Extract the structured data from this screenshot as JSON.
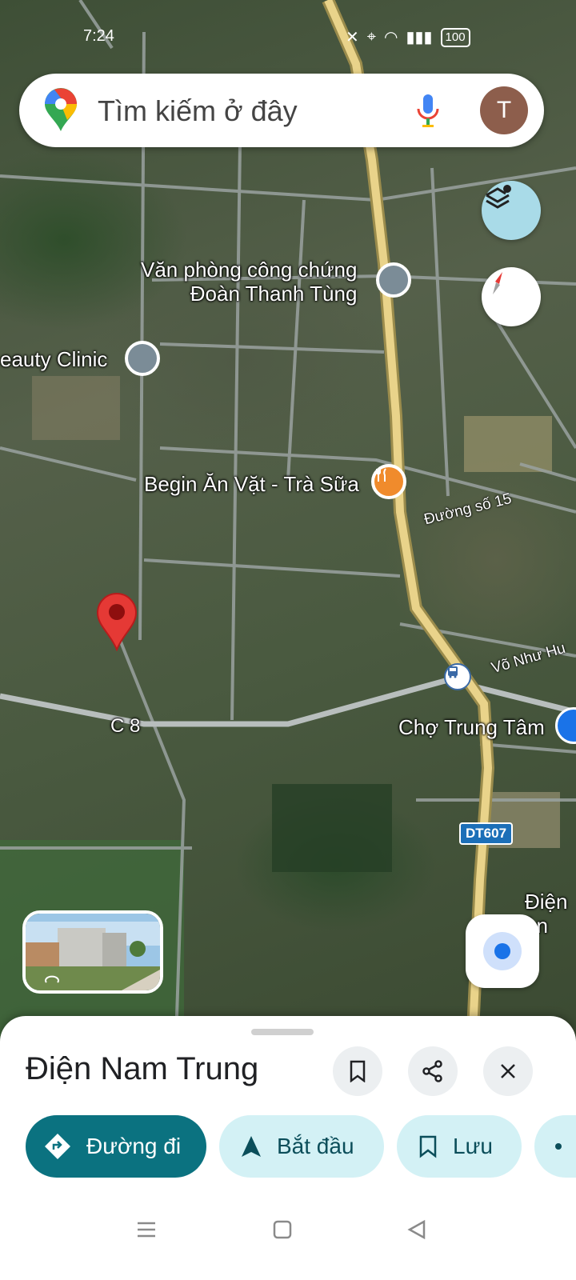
{
  "status_bar": {
    "time": "7:24",
    "battery": "100"
  },
  "search": {
    "placeholder": "Tìm kiếm ở đây",
    "avatar_initial": "T"
  },
  "map": {
    "place_labels": {
      "notary": "Văn phòng công chứng\nĐoàn Thanh Tùng",
      "beauty": "eauty Clinic",
      "begin": "Begin Ăn Vặt - Trà Sữa",
      "market": "Chợ Trung Tâm",
      "dien_partial": "Điện\nàn"
    },
    "road_labels": {
      "duong15": "Đường số 15",
      "vo_nhu": "Võ Như Hu",
      "c8": "C 8",
      "dt607": "DT607"
    },
    "icons": [
      "layers-icon",
      "compass-icon",
      "my-location-icon",
      "street-view-icon",
      "bus-stop-icon",
      "restaurant-icon"
    ]
  },
  "sheet": {
    "title": "Điện Nam Trung",
    "actions": {
      "directions": "Đường đi",
      "start": "Bắt đầu",
      "save": "Lưu"
    }
  },
  "colors": {
    "primary_chip": "#0b7280",
    "secondary_chip": "#d3f1f5",
    "pin_red": "#e53935",
    "road_yellow": "#e9d38a"
  }
}
